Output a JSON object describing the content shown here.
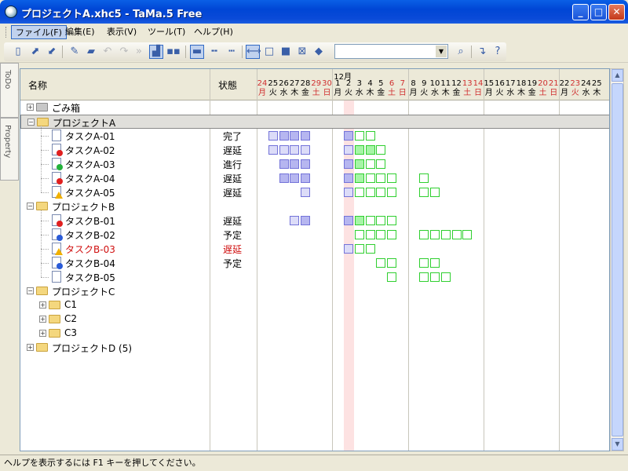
{
  "window": {
    "title": "プロジェクトA.xhc5 - TaMa.5 Free",
    "min": "_",
    "max": "□",
    "close": "✕"
  },
  "menu": [
    "ファイル(F)",
    "編集(E)",
    "表示(V)",
    "ツール(T)",
    "ヘルプ(H)"
  ],
  "toolbar_icons": [
    "new-file",
    "open",
    "export",
    "edit",
    "folder",
    "undo",
    "redo",
    "jump",
    "view-gantt",
    "view-split",
    "view-bar",
    "view-dashed",
    "view-dots",
    "range",
    "square",
    "fill-square",
    "cross-square",
    "eraser",
    "search",
    "goto",
    "help"
  ],
  "search_combo": {
    "value": ""
  },
  "side_tabs": [
    "ToDo",
    "Property"
  ],
  "columns": {
    "name": "名称",
    "status": "状態"
  },
  "calendar": {
    "month_label": "12月",
    "days": [
      {
        "d": "24",
        "w": "月",
        "red": true
      },
      {
        "d": "25",
        "w": "火",
        "red": false
      },
      {
        "d": "26",
        "w": "水",
        "red": false
      },
      {
        "d": "27",
        "w": "木",
        "red": false
      },
      {
        "d": "28",
        "w": "金",
        "red": false
      },
      {
        "d": "29",
        "w": "土",
        "red": true
      },
      {
        "d": "30",
        "w": "日",
        "red": true
      },
      {
        "d": "1",
        "w": "月",
        "red": false
      },
      {
        "d": "2",
        "w": "火",
        "red": false
      },
      {
        "d": "3",
        "w": "水",
        "red": false
      },
      {
        "d": "4",
        "w": "木",
        "red": false
      },
      {
        "d": "5",
        "w": "金",
        "red": false
      },
      {
        "d": "6",
        "w": "土",
        "red": true
      },
      {
        "d": "7",
        "w": "日",
        "red": true
      },
      {
        "d": "8",
        "w": "月",
        "red": false
      },
      {
        "d": "9",
        "w": "火",
        "red": false
      },
      {
        "d": "10",
        "w": "水",
        "red": false
      },
      {
        "d": "11",
        "w": "木",
        "red": false
      },
      {
        "d": "12",
        "w": "金",
        "red": false
      },
      {
        "d": "13",
        "w": "土",
        "red": true
      },
      {
        "d": "14",
        "w": "日",
        "red": true
      },
      {
        "d": "15",
        "w": "月",
        "red": false
      },
      {
        "d": "16",
        "w": "火",
        "red": false
      },
      {
        "d": "17",
        "w": "水",
        "red": false
      },
      {
        "d": "18",
        "w": "木",
        "red": false
      },
      {
        "d": "19",
        "w": "金",
        "red": false
      },
      {
        "d": "20",
        "w": "土",
        "red": true
      },
      {
        "d": "21",
        "w": "日",
        "red": true
      },
      {
        "d": "22",
        "w": "月",
        "red": false
      },
      {
        "d": "23",
        "w": "火",
        "red": true
      },
      {
        "d": "24",
        "w": "水",
        "red": false
      },
      {
        "d": "25",
        "w": "木",
        "red": false
      }
    ],
    "today_index": 8
  },
  "rows": [
    {
      "kind": "folder",
      "label": "ごみ箱",
      "level": 0,
      "icon": "trash",
      "exp": "+",
      "status": "",
      "bars": []
    },
    {
      "kind": "folder",
      "label": "プロジェクトA",
      "level": 0,
      "icon": "folder",
      "exp": "-",
      "status": "",
      "selected": true,
      "bars": []
    },
    {
      "kind": "task",
      "label": "タスクA-01",
      "level": 1,
      "badge": "none",
      "status": "完了",
      "bars": [
        [
          1,
          "bl"
        ],
        [
          2,
          "b"
        ],
        [
          3,
          "b"
        ],
        [
          4,
          "b"
        ],
        [
          8,
          "b"
        ],
        [
          9,
          "gl"
        ],
        [
          10,
          "gl"
        ]
      ]
    },
    {
      "kind": "task",
      "label": "タスクA-02",
      "level": 1,
      "badge": "red",
      "status": "遅延",
      "bars": [
        [
          1,
          "bl"
        ],
        [
          2,
          "bl"
        ],
        [
          3,
          "bl"
        ],
        [
          4,
          "bl"
        ],
        [
          8,
          "bl"
        ],
        [
          9,
          "g"
        ],
        [
          10,
          "g"
        ],
        [
          11,
          "gl"
        ]
      ]
    },
    {
      "kind": "task",
      "label": "タスクA-03",
      "level": 1,
      "badge": "green",
      "status": "進行",
      "bars": [
        [
          2,
          "b"
        ],
        [
          3,
          "b"
        ],
        [
          4,
          "b"
        ],
        [
          8,
          "b"
        ],
        [
          9,
          "g"
        ],
        [
          10,
          "gl"
        ],
        [
          11,
          "gl"
        ]
      ]
    },
    {
      "kind": "task",
      "label": "タスクA-04",
      "level": 1,
      "badge": "red",
      "status": "遅延",
      "bars": [
        [
          2,
          "b"
        ],
        [
          3,
          "b"
        ],
        [
          4,
          "b"
        ],
        [
          8,
          "b"
        ],
        [
          9,
          "g"
        ],
        [
          10,
          "gl"
        ],
        [
          11,
          "gl"
        ],
        [
          12,
          "gl"
        ],
        [
          15,
          "gl"
        ]
      ]
    },
    {
      "kind": "task",
      "label": "タスクA-05",
      "level": 1,
      "badge": "warn",
      "status": "遅延",
      "bars": [
        [
          4,
          "bl"
        ],
        [
          8,
          "bl"
        ],
        [
          9,
          "gl"
        ],
        [
          10,
          "gl"
        ],
        [
          11,
          "gl"
        ],
        [
          12,
          "gl"
        ],
        [
          15,
          "gl"
        ],
        [
          16,
          "gl"
        ]
      ]
    },
    {
      "kind": "folder",
      "label": "プロジェクトB",
      "level": 0,
      "icon": "folder",
      "exp": "-",
      "status": "",
      "bars": []
    },
    {
      "kind": "task",
      "label": "タスクB-01",
      "level": 1,
      "badge": "red",
      "status": "遅延",
      "bars": [
        [
          3,
          "bl"
        ],
        [
          4,
          "b"
        ],
        [
          8,
          "b"
        ],
        [
          9,
          "g"
        ],
        [
          10,
          "gl"
        ],
        [
          11,
          "gl"
        ],
        [
          12,
          "gl"
        ]
      ]
    },
    {
      "kind": "task",
      "label": "タスクB-02",
      "level": 1,
      "badge": "blue",
      "status": "予定",
      "bars": [
        [
          9,
          "gl"
        ],
        [
          10,
          "gl"
        ],
        [
          11,
          "gl"
        ],
        [
          12,
          "gl"
        ],
        [
          15,
          "gl"
        ],
        [
          16,
          "gl"
        ],
        [
          17,
          "gl"
        ],
        [
          18,
          "gl"
        ],
        [
          19,
          "gl"
        ]
      ]
    },
    {
      "kind": "task",
      "label": "タスクB-03",
      "level": 1,
      "badge": "warn",
      "status": "遅延",
      "red": true,
      "bars": [
        [
          8,
          "bl"
        ],
        [
          9,
          "gl"
        ],
        [
          10,
          "gl"
        ]
      ]
    },
    {
      "kind": "task",
      "label": "タスクB-04",
      "level": 1,
      "badge": "blue",
      "status": "予定",
      "bars": [
        [
          11,
          "gl"
        ],
        [
          12,
          "gl"
        ],
        [
          15,
          "gl"
        ],
        [
          16,
          "gl"
        ]
      ]
    },
    {
      "kind": "task",
      "label": "タスクB-05",
      "level": 1,
      "badge": "none",
      "status": "",
      "bars": [
        [
          12,
          "gl"
        ],
        [
          15,
          "gl"
        ],
        [
          16,
          "gl"
        ],
        [
          17,
          "gl"
        ]
      ]
    },
    {
      "kind": "folder",
      "label": "プロジェクトC",
      "level": 0,
      "icon": "folder",
      "exp": "-",
      "status": "",
      "bars": []
    },
    {
      "kind": "folder",
      "label": "C1",
      "level": 1,
      "icon": "folder",
      "exp": "+",
      "status": "",
      "bars": []
    },
    {
      "kind": "folder",
      "label": "C2",
      "level": 1,
      "icon": "folder",
      "exp": "+",
      "status": "",
      "bars": []
    },
    {
      "kind": "folder",
      "label": "C3",
      "level": 1,
      "icon": "folder",
      "exp": "+",
      "status": "",
      "bars": []
    },
    {
      "kind": "folder",
      "label": "プロジェクトD (5)",
      "level": 0,
      "icon": "folder",
      "exp": "+",
      "status": "",
      "bars": []
    }
  ],
  "statusbar": "ヘルプを表示するには F1 キーを押してください。"
}
